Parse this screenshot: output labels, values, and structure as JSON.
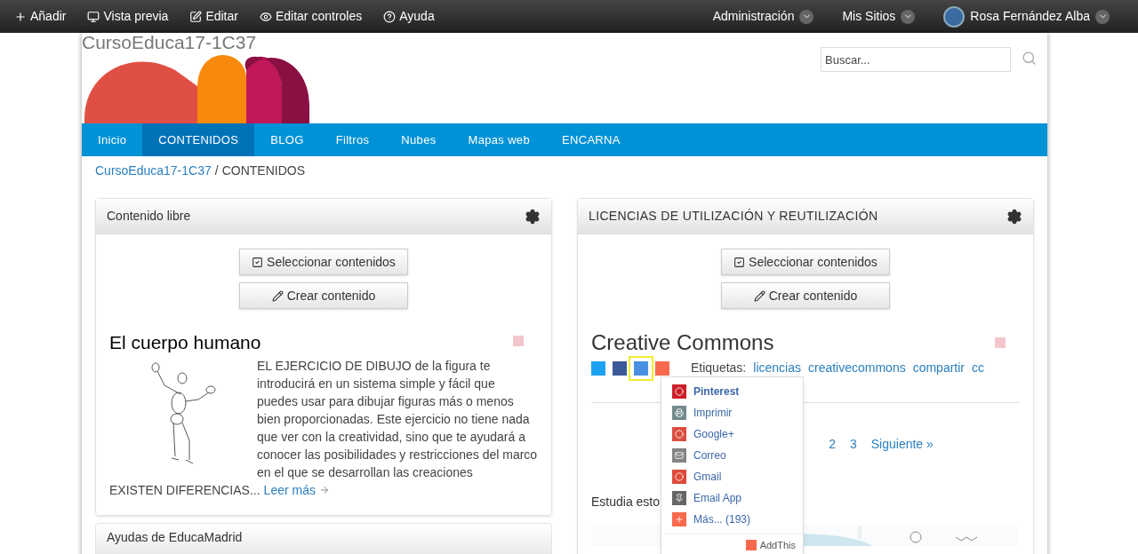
{
  "toolbar": {
    "left": [
      {
        "label": "Añadir"
      },
      {
        "label": "Vista previa"
      },
      {
        "label": "Editar"
      },
      {
        "label": "Editar controles"
      },
      {
        "label": "Ayuda"
      }
    ],
    "right": [
      {
        "kind": "menu",
        "label": "Administración"
      },
      {
        "kind": "menu",
        "label": "Mis Sitios"
      },
      {
        "kind": "user",
        "label": "Rosa Fernández Alba"
      }
    ]
  },
  "site": {
    "title": "CursoEduca17-1C37",
    "search": {
      "placeholder": "Buscar..."
    }
  },
  "nav": [
    {
      "label": "Inicio",
      "selected": false
    },
    {
      "label": "CONTENIDOS",
      "selected": true
    },
    {
      "label": "BLOG",
      "selected": false
    },
    {
      "label": "Filtros",
      "selected": false
    },
    {
      "label": "Nubes",
      "selected": false
    },
    {
      "label": "Mapas web",
      "selected": false
    },
    {
      "label": "ENCARNA",
      "selected": false
    }
  ],
  "breadcrumb": {
    "link": "CursoEduca17-1C37",
    "separator": "/",
    "current": "CONTENIDOS"
  },
  "left_panel": {
    "title": "Contenido libre",
    "buttons": [
      {
        "label": "Seleccionar contenidos"
      },
      {
        "label": "Crear contenido"
      }
    ],
    "article": {
      "title": "El cuerpo humano",
      "body": "EL EJERCICIO DE DIBUJO de la figura te introducirá en un sistema simple y fácil que puedes usar para dibujar figuras más o menos bien proporcionadas. Este ejercicio no tiene nada que ver con la creatividad, sino que te ayudará a conocer las posibilidades y restricciones del marco en el que se desarrollan las creaciones",
      "tail": "EXISTEN DIFERENCIAS...",
      "more": "Leer más"
    }
  },
  "left_panel_2": {
    "title": "Ayudas de EducaMadrid"
  },
  "right_panel": {
    "title": "LICENCIAS DE UTILIZACIÓN Y REUTILIZACIÓN",
    "buttons": [
      {
        "label": "Seleccionar contenidos"
      },
      {
        "label": "Crear contenido"
      }
    ],
    "article": {
      "title": "Creative Commons",
      "tags_label": "Etiquetas:",
      "tags": [
        "licencias",
        "creativecommons",
        "compartir",
        "cc"
      ]
    },
    "pagination": [
      "2",
      "3",
      "Siguiente »"
    ],
    "text": "Estudia esto"
  },
  "share_menu": {
    "items": [
      {
        "label": "Pinterest",
        "color": "#cb2027",
        "selected": true
      },
      {
        "label": "Imprimir",
        "color": "#738a8d",
        "selected": false
      },
      {
        "label": "Google+",
        "color": "#dc4e41",
        "selected": false
      },
      {
        "label": "Correo",
        "color": "#848484",
        "selected": false
      },
      {
        "label": "Gmail",
        "color": "#dd4b39",
        "selected": false
      },
      {
        "label": "Email App",
        "color": "#666666",
        "selected": false
      },
      {
        "label": "Más... (193)",
        "color": "#f8694d",
        "selected": false
      }
    ],
    "brand": "AddThis"
  }
}
